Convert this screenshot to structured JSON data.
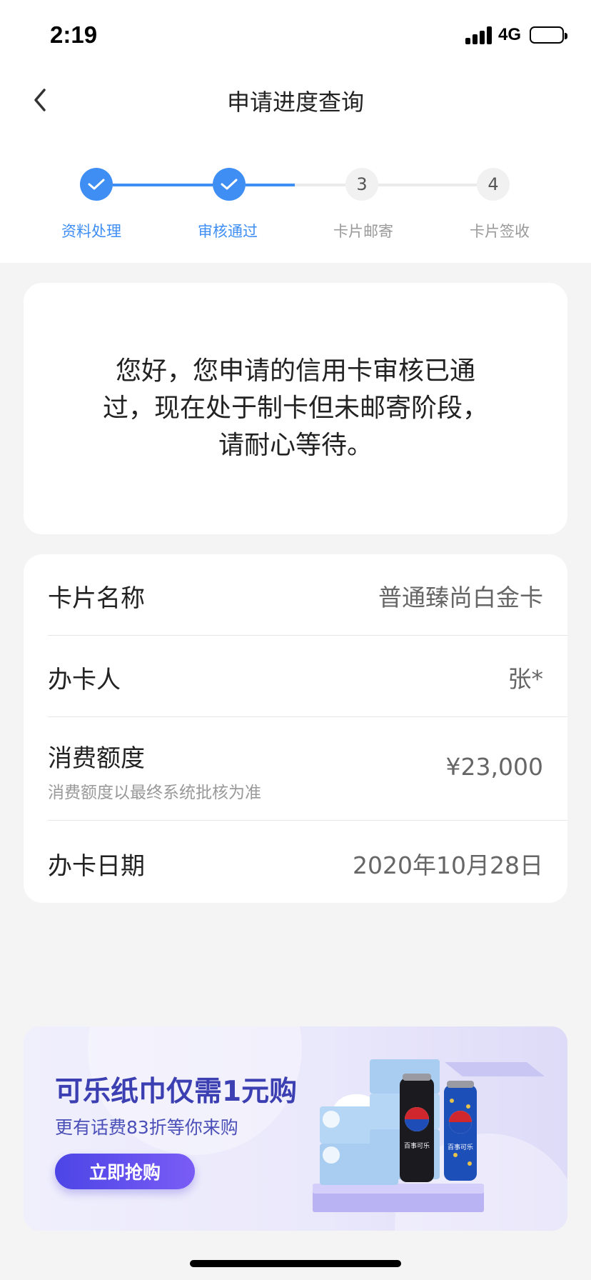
{
  "status_bar": {
    "time": "2:19",
    "network": "4G"
  },
  "nav": {
    "title": "申请进度查询",
    "back_icon": "chevron-left-icon"
  },
  "steps": [
    {
      "label": "资料处理",
      "state": "done",
      "number": ""
    },
    {
      "label": "审核通过",
      "state": "done",
      "number": ""
    },
    {
      "label": "卡片邮寄",
      "state": "todo",
      "number": "3"
    },
    {
      "label": "卡片签收",
      "state": "todo",
      "number": "4"
    }
  ],
  "message": "您好，您申请的信用卡审核已通过，现在处于制卡但未邮寄阶段，请耐心等待。",
  "details": {
    "card_name": {
      "label": "卡片名称",
      "value": "普通臻尚白金卡"
    },
    "applicant": {
      "label": "办卡人",
      "value": "张*"
    },
    "limit": {
      "label": "消费额度",
      "note": "消费额度以最终系统批核为准",
      "value": "¥23,000"
    },
    "date": {
      "label": "办卡日期",
      "value": "2020年10月28日"
    }
  },
  "banner": {
    "title": "可乐纸巾仅需1元购",
    "subtitle": "更有话费83折等你来购",
    "button": "立即抢购",
    "can_brand": "百事可乐"
  },
  "colors": {
    "accent": "#3e8ef4",
    "banner_title": "#3b3fb2",
    "banner_button": "#5a4ff0"
  }
}
